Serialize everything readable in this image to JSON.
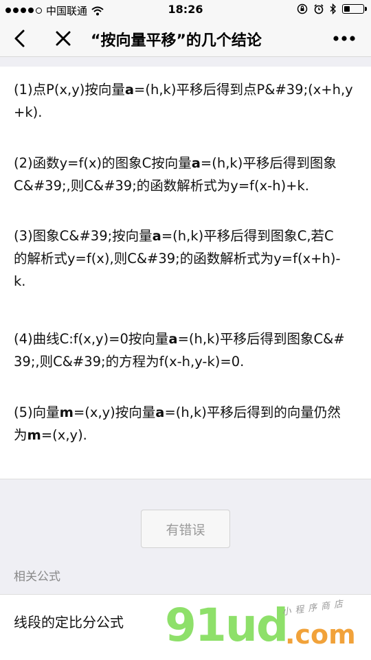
{
  "status_bar": {
    "carrier": "中国联通",
    "time": "18:26"
  },
  "nav": {
    "title": "“按向量平移”的几个结论"
  },
  "content": {
    "p1": {
      "pre": "(1)点P(x,y)按向量",
      "bold": "a",
      "post1": "=(h,k)平移后得到点P&#39;(x+h,y",
      "post2": "+k)."
    },
    "p2": {
      "pre": "(2)函数y=f(x)的图象C按向量",
      "bold": "a",
      "post1": "=(h,k)平移后得到图象",
      "post2": "C&#39;,则C&#39;的函数解析式为y=f(x-h)+k."
    },
    "p3": {
      "pre": "(3)图象C&#39;按向量",
      "bold": "a",
      "post1": "=(h,k)平移后得到图象C,若C",
      "post2": "的解析式y=f(x),则C&#39;的函数解析式为y=f(x+h)-",
      "post3": "k."
    },
    "p4": {
      "pre": "(4)曲线C:f(x,y)=0按向量",
      "bold": "a",
      "post1": "=(h,k)平移后得到图象C&#",
      "post2": "39;,则C&#39;的方程为f(x-h,y-k)=0."
    },
    "p5": {
      "pre": "(5)向量",
      "bold1": "m",
      "mid1": "=(x,y)按向量",
      "bold2": "a",
      "mid2": "=(h,k)平移后得到的向量仍然",
      "line2_pre": "为",
      "bold3": "m",
      "line2_post": "=(x,y)."
    }
  },
  "error_button": "有错误",
  "related": {
    "label": "相关公式",
    "items": [
      "线段的定比分公式"
    ]
  },
  "watermark": {
    "main": "91ud",
    "dotcom": ".com",
    "sub": "小程序商店"
  }
}
